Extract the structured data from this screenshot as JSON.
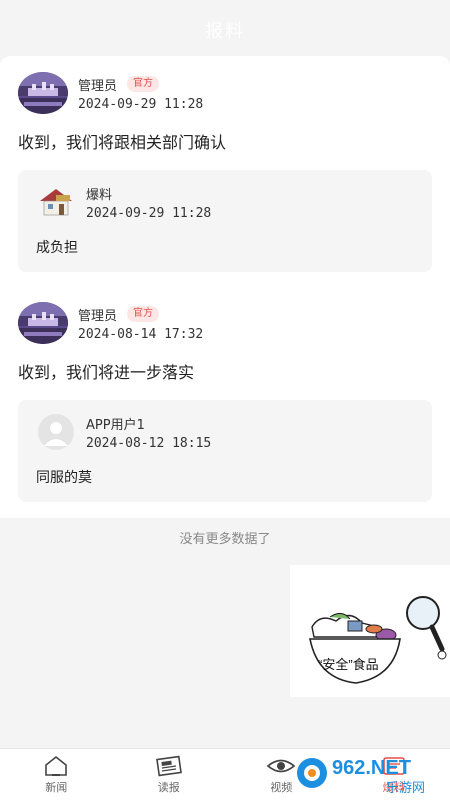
{
  "header": {
    "title": "报料"
  },
  "posts": [
    {
      "author": "管理员",
      "badge": "官方",
      "time": "2024-09-29  11:28",
      "reply": "收到，我们将跟相关部门确认",
      "quote": {
        "author": "爆料",
        "time": "2024-09-29  11:28",
        "text": "成负担"
      }
    },
    {
      "author": "管理员",
      "badge": "官方",
      "time": "2024-08-14  17:32",
      "reply": "收到，我们将进一步落实",
      "quote": {
        "author": "APP用户1",
        "time": "2024-08-12  18:15",
        "text": "同服的莫"
      }
    }
  ],
  "footer_note": "没有更多数据了",
  "ad": {
    "caption": "“安全”食品"
  },
  "tabs": [
    {
      "label": "新闻",
      "icon": "home-icon"
    },
    {
      "label": "读报",
      "icon": "newspaper-icon"
    },
    {
      "label": "视频",
      "icon": "eye-icon"
    },
    {
      "label": "爆料",
      "icon": "report-icon",
      "active": true
    }
  ],
  "watermark": {
    "text": "962.NET",
    "subtext": "乐游网"
  },
  "colors": {
    "accent": "#e0504a",
    "badge_bg": "#fde7e6",
    "page_bg": "#f4f4f4"
  }
}
